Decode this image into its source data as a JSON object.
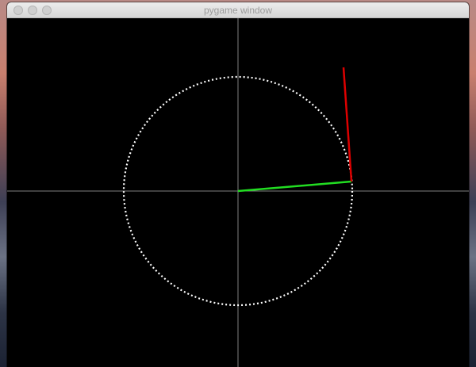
{
  "window": {
    "title": "pygame window"
  },
  "colors": {
    "canvas_background": "#000000",
    "axis_color": "#808080",
    "circle_color": "#ffffff",
    "radius_line_color": "#22dd22",
    "tangent_line_color": "#dd0000"
  },
  "icons": {
    "close": "close-button",
    "minimize": "minimize-button",
    "zoom": "zoom-button"
  }
}
